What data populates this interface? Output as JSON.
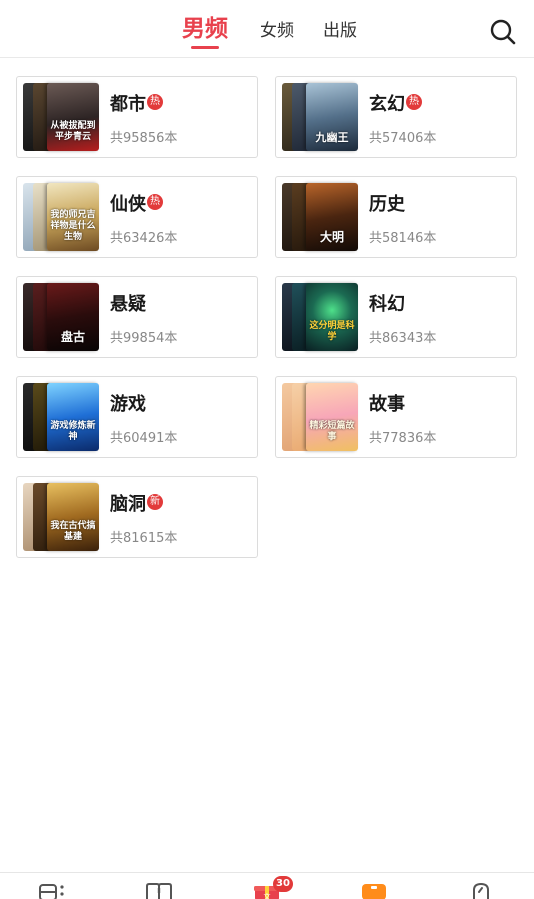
{
  "header": {
    "tabs": [
      {
        "label": "男频",
        "active": true
      },
      {
        "label": "女频",
        "active": false
      },
      {
        "label": "出版",
        "active": false
      }
    ],
    "search_icon": "search-icon"
  },
  "categories": [
    {
      "name": "都市",
      "badge": "热",
      "count": "共95856本",
      "cover_text": "从被拔配到平步青云"
    },
    {
      "name": "玄幻",
      "badge": "热",
      "count": "共57406本",
      "cover_text": "九幽王"
    },
    {
      "name": "仙侠",
      "badge": "热",
      "count": "共63426本",
      "cover_text": "我的师兄吉祥物是什么生物"
    },
    {
      "name": "历史",
      "badge": "",
      "count": "共58146本",
      "cover_text": "大明"
    },
    {
      "name": "悬疑",
      "badge": "",
      "count": "共99854本",
      "cover_text": "盘古"
    },
    {
      "name": "科幻",
      "badge": "",
      "count": "共86343本",
      "cover_text": "这分明是科学"
    },
    {
      "name": "游戏",
      "badge": "",
      "count": "共60491本",
      "cover_text": "游戏修炼新神"
    },
    {
      "name": "故事",
      "badge": "",
      "count": "共77836本",
      "cover_text": "精彩短篇故事"
    },
    {
      "name": "脑洞",
      "badge": "新",
      "count": "共81615本",
      "cover_text": "我在古代搞基建"
    }
  ],
  "bottom_nav": {
    "items": [
      {
        "icon": "bookshelf-icon"
      },
      {
        "icon": "book-icon"
      },
      {
        "icon": "gift-icon",
        "badge": "30"
      },
      {
        "icon": "category-icon",
        "active": true
      },
      {
        "icon": "profile-icon"
      }
    ]
  },
  "colors": {
    "accent": "#e8414d",
    "badge": "#e23a3a",
    "active_nav": "#ff8c1a"
  }
}
